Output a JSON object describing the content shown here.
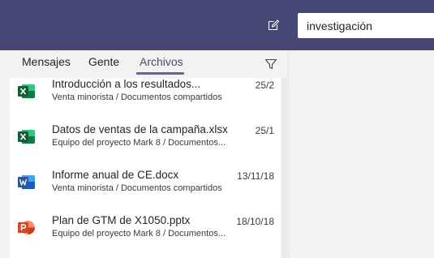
{
  "header": {
    "compose_icon": "compose-icon",
    "search": {
      "value": "investigación",
      "placeholder": ""
    }
  },
  "tabs": [
    {
      "label": "Mensajes",
      "active": false
    },
    {
      "label": "Gente",
      "active": false
    },
    {
      "label": "Archivos",
      "active": true
    }
  ],
  "filter_icon": "filter-icon",
  "files": [
    {
      "name": "Introducción a los resultados...",
      "path": "Venta minorista / Documentos compartidos",
      "date": "25/2",
      "type": "excel"
    },
    {
      "name": "Datos de ventas de la campaña.xlsx",
      "path": "Equipo del proyecto Mark 8 / Documentos...",
      "date": "25/1",
      "type": "excel"
    },
    {
      "name": "Informe anual de CE.docx",
      "path": "Venta minorista / Documentos compartidos",
      "date": "13/11/18",
      "type": "word"
    },
    {
      "name": "Plan de GTM de X1050.pptx",
      "path": "Equipo del proyecto Mark 8 / Documentos...",
      "date": "18/10/18",
      "type": "powerpoint"
    }
  ],
  "colors": {
    "topbar": "#464775",
    "accent": "#6264a7",
    "excel": "#217346",
    "word": "#2b579a",
    "powerpoint": "#d24726"
  }
}
